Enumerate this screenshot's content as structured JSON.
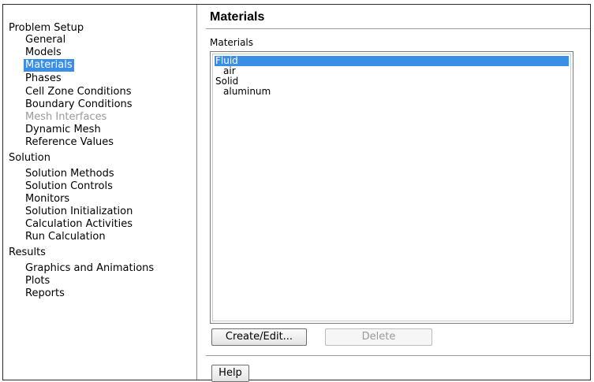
{
  "tree": {
    "sections": [
      {
        "label": "Problem Setup",
        "items": [
          {
            "label": "General"
          },
          {
            "label": "Models"
          },
          {
            "label": "Materials"
          },
          {
            "label": "Phases"
          },
          {
            "label": "Cell Zone Conditions"
          },
          {
            "label": "Boundary Conditions"
          },
          {
            "label": "Mesh Interfaces"
          },
          {
            "label": "Dynamic Mesh"
          },
          {
            "label": "Reference Values"
          }
        ]
      },
      {
        "label": "Solution",
        "items": [
          {
            "label": "Solution Methods"
          },
          {
            "label": "Solution Controls"
          },
          {
            "label": "Monitors"
          },
          {
            "label": "Solution Initialization"
          },
          {
            "label": "Calculation Activities"
          },
          {
            "label": "Run Calculation"
          }
        ]
      },
      {
        "label": "Results",
        "items": [
          {
            "label": "Graphics and Animations"
          },
          {
            "label": "Plots"
          },
          {
            "label": "Reports"
          }
        ]
      }
    ],
    "selected_item": "Materials",
    "disabled_item": "Mesh Interfaces"
  },
  "panel": {
    "title": "Materials",
    "list_label": "Materials",
    "list_items": [
      {
        "label": "Fluid"
      },
      {
        "label": "air"
      },
      {
        "label": "Solid"
      },
      {
        "label": "aluminum"
      }
    ],
    "selected_list_item": "Fluid",
    "buttons": {
      "create_edit": "Create/Edit...",
      "delete": "Delete",
      "help": "Help"
    }
  },
  "colors": {
    "selection": "#3a8ee6",
    "disabled_text": "#9a9a9a",
    "border": "#2a2a2a"
  }
}
